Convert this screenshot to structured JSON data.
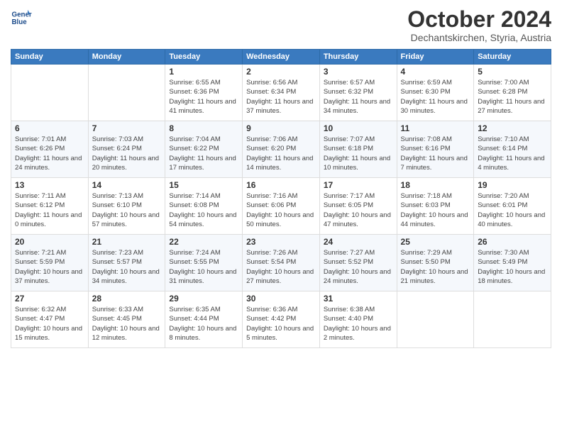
{
  "header": {
    "logo_general": "General",
    "logo_blue": "Blue",
    "month_title": "October 2024",
    "location": "Dechantskirchen, Styria, Austria"
  },
  "days_of_week": [
    "Sunday",
    "Monday",
    "Tuesday",
    "Wednesday",
    "Thursday",
    "Friday",
    "Saturday"
  ],
  "weeks": [
    [
      {
        "day": "",
        "info": ""
      },
      {
        "day": "",
        "info": ""
      },
      {
        "day": "1",
        "info": "Sunrise: 6:55 AM\nSunset: 6:36 PM\nDaylight: 11 hours and 41 minutes."
      },
      {
        "day": "2",
        "info": "Sunrise: 6:56 AM\nSunset: 6:34 PM\nDaylight: 11 hours and 37 minutes."
      },
      {
        "day": "3",
        "info": "Sunrise: 6:57 AM\nSunset: 6:32 PM\nDaylight: 11 hours and 34 minutes."
      },
      {
        "day": "4",
        "info": "Sunrise: 6:59 AM\nSunset: 6:30 PM\nDaylight: 11 hours and 30 minutes."
      },
      {
        "day": "5",
        "info": "Sunrise: 7:00 AM\nSunset: 6:28 PM\nDaylight: 11 hours and 27 minutes."
      }
    ],
    [
      {
        "day": "6",
        "info": "Sunrise: 7:01 AM\nSunset: 6:26 PM\nDaylight: 11 hours and 24 minutes."
      },
      {
        "day": "7",
        "info": "Sunrise: 7:03 AM\nSunset: 6:24 PM\nDaylight: 11 hours and 20 minutes."
      },
      {
        "day": "8",
        "info": "Sunrise: 7:04 AM\nSunset: 6:22 PM\nDaylight: 11 hours and 17 minutes."
      },
      {
        "day": "9",
        "info": "Sunrise: 7:06 AM\nSunset: 6:20 PM\nDaylight: 11 hours and 14 minutes."
      },
      {
        "day": "10",
        "info": "Sunrise: 7:07 AM\nSunset: 6:18 PM\nDaylight: 11 hours and 10 minutes."
      },
      {
        "day": "11",
        "info": "Sunrise: 7:08 AM\nSunset: 6:16 PM\nDaylight: 11 hours and 7 minutes."
      },
      {
        "day": "12",
        "info": "Sunrise: 7:10 AM\nSunset: 6:14 PM\nDaylight: 11 hours and 4 minutes."
      }
    ],
    [
      {
        "day": "13",
        "info": "Sunrise: 7:11 AM\nSunset: 6:12 PM\nDaylight: 11 hours and 0 minutes."
      },
      {
        "day": "14",
        "info": "Sunrise: 7:13 AM\nSunset: 6:10 PM\nDaylight: 10 hours and 57 minutes."
      },
      {
        "day": "15",
        "info": "Sunrise: 7:14 AM\nSunset: 6:08 PM\nDaylight: 10 hours and 54 minutes."
      },
      {
        "day": "16",
        "info": "Sunrise: 7:16 AM\nSunset: 6:06 PM\nDaylight: 10 hours and 50 minutes."
      },
      {
        "day": "17",
        "info": "Sunrise: 7:17 AM\nSunset: 6:05 PM\nDaylight: 10 hours and 47 minutes."
      },
      {
        "day": "18",
        "info": "Sunrise: 7:18 AM\nSunset: 6:03 PM\nDaylight: 10 hours and 44 minutes."
      },
      {
        "day": "19",
        "info": "Sunrise: 7:20 AM\nSunset: 6:01 PM\nDaylight: 10 hours and 40 minutes."
      }
    ],
    [
      {
        "day": "20",
        "info": "Sunrise: 7:21 AM\nSunset: 5:59 PM\nDaylight: 10 hours and 37 minutes."
      },
      {
        "day": "21",
        "info": "Sunrise: 7:23 AM\nSunset: 5:57 PM\nDaylight: 10 hours and 34 minutes."
      },
      {
        "day": "22",
        "info": "Sunrise: 7:24 AM\nSunset: 5:55 PM\nDaylight: 10 hours and 31 minutes."
      },
      {
        "day": "23",
        "info": "Sunrise: 7:26 AM\nSunset: 5:54 PM\nDaylight: 10 hours and 27 minutes."
      },
      {
        "day": "24",
        "info": "Sunrise: 7:27 AM\nSunset: 5:52 PM\nDaylight: 10 hours and 24 minutes."
      },
      {
        "day": "25",
        "info": "Sunrise: 7:29 AM\nSunset: 5:50 PM\nDaylight: 10 hours and 21 minutes."
      },
      {
        "day": "26",
        "info": "Sunrise: 7:30 AM\nSunset: 5:49 PM\nDaylight: 10 hours and 18 minutes."
      }
    ],
    [
      {
        "day": "27",
        "info": "Sunrise: 6:32 AM\nSunset: 4:47 PM\nDaylight: 10 hours and 15 minutes."
      },
      {
        "day": "28",
        "info": "Sunrise: 6:33 AM\nSunset: 4:45 PM\nDaylight: 10 hours and 12 minutes."
      },
      {
        "day": "29",
        "info": "Sunrise: 6:35 AM\nSunset: 4:44 PM\nDaylight: 10 hours and 8 minutes."
      },
      {
        "day": "30",
        "info": "Sunrise: 6:36 AM\nSunset: 4:42 PM\nDaylight: 10 hours and 5 minutes."
      },
      {
        "day": "31",
        "info": "Sunrise: 6:38 AM\nSunset: 4:40 PM\nDaylight: 10 hours and 2 minutes."
      },
      {
        "day": "",
        "info": ""
      },
      {
        "day": "",
        "info": ""
      }
    ]
  ]
}
